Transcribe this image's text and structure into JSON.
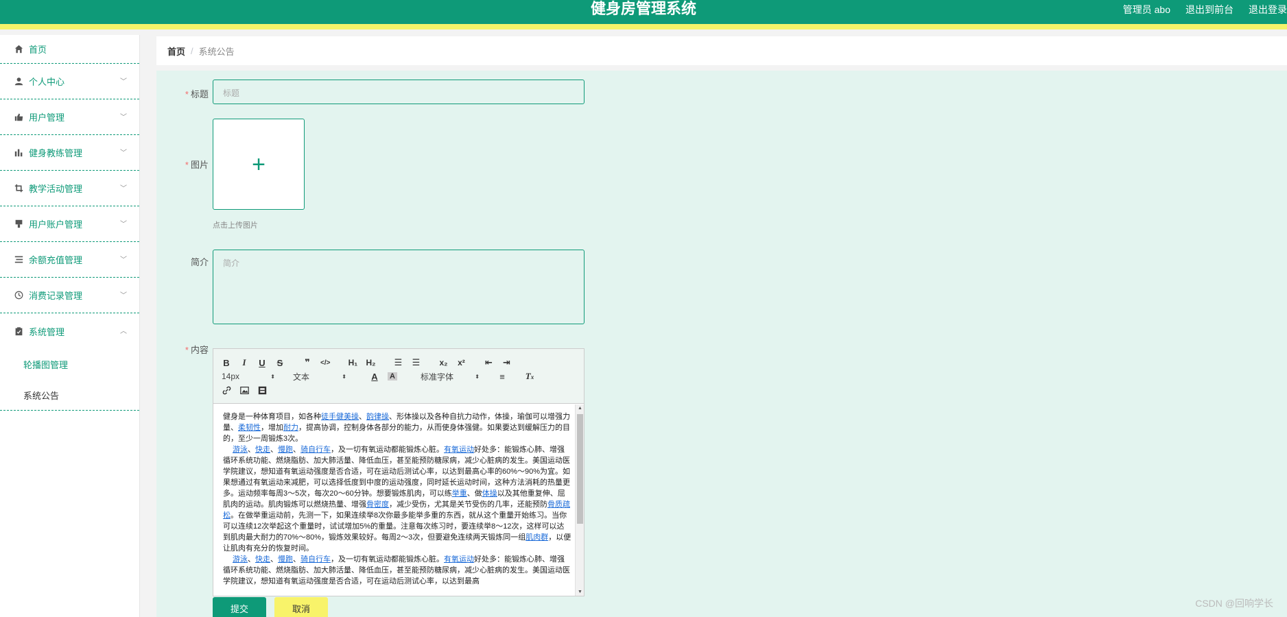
{
  "header": {
    "title": "健身房管理系统",
    "user": "管理员 abo",
    "to_front": "退出到前台",
    "logout": "退出登录"
  },
  "sidebar": {
    "items": [
      {
        "label": "首页",
        "icon": "home-icon"
      },
      {
        "label": "个人中心",
        "icon": "user-icon"
      },
      {
        "label": "用户管理",
        "icon": "thumb-icon"
      },
      {
        "label": "健身教练管理",
        "icon": "bar-chart-icon"
      },
      {
        "label": "教学活动管理",
        "icon": "crop-icon"
      },
      {
        "label": "用户账户管理",
        "icon": "stamp-icon"
      },
      {
        "label": "余额充值管理",
        "icon": "list-icon"
      },
      {
        "label": "消费记录管理",
        "icon": "clock-icon"
      },
      {
        "label": "系统管理",
        "icon": "clipboard-icon"
      }
    ],
    "subitems": [
      "轮播图管理",
      "系统公告"
    ]
  },
  "breadcrumb": {
    "home": "首页",
    "sep": "/",
    "current": "系统公告"
  },
  "form": {
    "title_label": "标题",
    "title_placeholder": "标题",
    "image_label": "图片",
    "image_hint": "点击上传图片",
    "intro_label": "简介",
    "intro_placeholder": "简介",
    "content_label": "内容",
    "required_mark": "*"
  },
  "editor": {
    "font_size": "14px",
    "text_type": "文本",
    "font_family": "标准字体",
    "para1_a": "健身是一种体育项目，如各种",
    "link1": "徒手健美操",
    "para1_b": "、",
    "link2": "韵律操",
    "para1_c": "、形体操以及各种自抗力动作，体操，瑜伽可以增强力量、",
    "link3": "柔韧性",
    "para1_d": "，增加",
    "link4": "耐力",
    "para1_e": "，提高协调，控制身体各部分的能力，从而使身体强健。如果要达到缓解压力的目的，至少一周锻炼3次。",
    "link5": "游泳",
    "link6": "快走",
    "link7": "慢跑",
    "link8": "骑自行车",
    "para2_a": "，及一切有氧运动都能锻炼心脏。",
    "link9": "有氧运动",
    "para2_b": "好处多：能锻炼心肺、增强循环系统功能、燃烧脂肪、加大肺活量、降低血压，甚至能预防糖尿病，减少心脏病的发生。美国运动医学院建议，想知道有氧运动强度是否合适，可在运动后测试心率，以达到最高心率的60%～90%为宜。如果想通过有氧运动来减肥，可以选择低度到中度的运动强度，同时延长运动时间，这种方法消耗的热量更多。运动频率每周3～5次，每次20～60分钟。想要锻炼肌肉，可以练",
    "link10": "举重",
    "para2_c": "、做",
    "link11": "体操",
    "para2_d": "以及其他重复伸、屈肌肉的运动。肌肉锻炼可以燃烧热量、增强",
    "link12": "骨密度",
    "para2_e": "，减少受伤，尤其是关节受伤的几率，还能预防",
    "link13": "骨质疏松",
    "para2_f": "。在做举重运动前，先测一下，如果连续举8次你最多能举多重的东西，就从这个重量开始练习。当你可以连续12次举起这个重量时，试试增加5%的重量。注意每次练习时，要连续举8～12次，这样可以达到肌肉最大耐力的70%～80%，锻炼效果较好。每周2～3次，但要避免连续两天锻炼同一组",
    "link14": "肌肉群",
    "para2_g": "，以便让肌肉有充分的恢复时间。",
    "para3_a": "，及一切有氧运动都能锻炼心脏。",
    "para3_b": "好处多：能锻炼心肺、增强循环系统功能、燃烧脂肪、加大肺活量、降低血压，甚至能预防糖尿病，减少心脏病的发生。美国运动医学院建议，想知道有氧运动强度是否合适，可在运动后测试心率，以达到最高",
    "sep": "、"
  },
  "buttons": {
    "submit": "提交",
    "cancel": "取消"
  },
  "watermark": "CSDN @回响学长",
  "colors": {
    "primary": "#0e9a78",
    "accent": "#f8f36a",
    "form_bg": "#e3f4ef"
  }
}
